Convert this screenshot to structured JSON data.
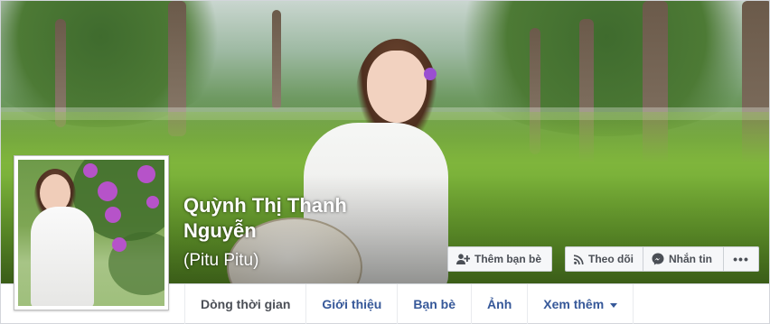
{
  "profile": {
    "name": "Quỳnh Thị Thanh Nguyễn",
    "alternate_name": "(Pitu Pitu)"
  },
  "actions": {
    "add_friend": {
      "label": "Thêm bạn bè",
      "icon": "add-friend-icon"
    },
    "follow": {
      "label": "Theo dõi",
      "icon": "rss-icon"
    },
    "message": {
      "label": "Nhắn tin",
      "icon": "messenger-icon"
    },
    "more": {
      "label": "•••",
      "icon": "more-icon"
    }
  },
  "tabs": [
    {
      "label": "Dòng thời gian"
    },
    {
      "label": "Giới thiệu"
    },
    {
      "label": "Bạn bè"
    },
    {
      "label": "Ảnh"
    },
    {
      "label": "Xem thêm"
    }
  ],
  "colors": {
    "link_blue": "#365899",
    "button_bg": "#f6f7f9",
    "button_text": "#4b4f56",
    "page_bg": "#e9ebee"
  }
}
